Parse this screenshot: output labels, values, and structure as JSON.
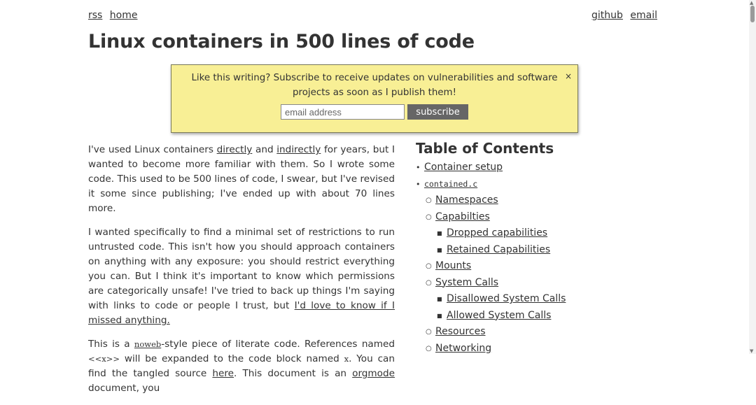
{
  "nav": {
    "left": [
      "rss",
      "home"
    ],
    "right": [
      "github",
      "email"
    ]
  },
  "title": "Linux containers in 500 lines of code",
  "popup": {
    "message": "Like this writing? Subscribe to receive updates on vulnerabilities and software projects as soon as I publish them!",
    "close": "×",
    "email_placeholder": "email address",
    "subscribe_label": "subscribe",
    "background": "#f8ef95"
  },
  "body": {
    "p1": {
      "a": "I've used Linux containers ",
      "link1": "directly",
      "b": " and ",
      "link2": "indirectly",
      "c": " for years, but I wanted to become more familiar with them. So I wrote some code. This used to be 500 lines of code, I swear, but I've revised it some since publishing; I've ended up with about 70 lines more."
    },
    "p2": {
      "a": "I wanted specifically to find a minimal set of restrictions to run untrusted code. This isn't how you should approach containers on anything with any exposure: you should restrict everything you can. But I think it's important to know which permissions are categorically unsafe! I've tried to back up things I'm saying with links to code or people I trust, but ",
      "link": "I'd love to know if I missed anything."
    },
    "p3": {
      "a": "This is a ",
      "link_noweb": "noweb",
      "b": "-style piece of literate code. References named ",
      "ref": "<<x>>",
      "c": " will be expanded to the code block named ",
      "x": "x",
      "d": ". You can find the tangled source ",
      "link_here": "here",
      "e": ". This document is an ",
      "link_orgmode": "orgmode",
      "f": " document, you"
    }
  },
  "toc": {
    "heading": "Table of Contents",
    "items": [
      {
        "level": 1,
        "label": "Container setup",
        "code": false
      },
      {
        "level": 1,
        "label": "contained.c",
        "code": true
      },
      {
        "level": 2,
        "label": "Namespaces",
        "code": false
      },
      {
        "level": 2,
        "label": "Capabilties",
        "code": false
      },
      {
        "level": 3,
        "label": "Dropped capabilities",
        "code": false
      },
      {
        "level": 3,
        "label": "Retained Capabilities",
        "code": false
      },
      {
        "level": 2,
        "label": "Mounts",
        "code": false
      },
      {
        "level": 2,
        "label": "System Calls",
        "code": false
      },
      {
        "level": 3,
        "label": "Disallowed System Calls",
        "code": false
      },
      {
        "level": 3,
        "label": "Allowed System Calls",
        "code": false
      },
      {
        "level": 2,
        "label": "Resources",
        "code": false
      },
      {
        "level": 2,
        "label": "Networking",
        "code": false
      }
    ]
  },
  "bullets": {
    "l1": "•",
    "l2": "○",
    "l3": "■"
  }
}
